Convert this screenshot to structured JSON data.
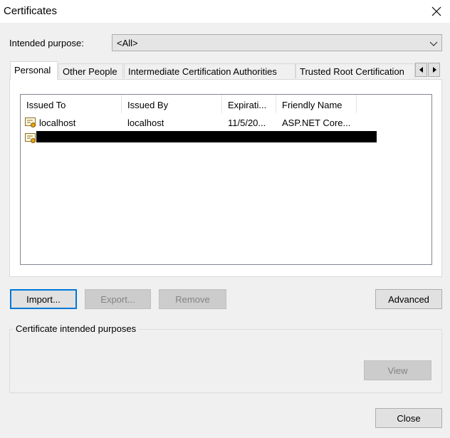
{
  "window": {
    "title": "Certificates"
  },
  "purpose": {
    "label": "Intended purpose:",
    "value": "<All>"
  },
  "tabs": [
    {
      "label": "Personal"
    },
    {
      "label": "Other People"
    },
    {
      "label": "Intermediate Certification Authorities"
    },
    {
      "label": "Trusted Root Certification"
    }
  ],
  "list": {
    "columns": [
      "Issued To",
      "Issued By",
      "Expirati...",
      "Friendly Name"
    ],
    "rows": [
      {
        "issued_to": "localhost",
        "issued_by": "localhost",
        "expiration": "11/5/20...",
        "friendly_name": "ASP.NET Core..."
      }
    ]
  },
  "buttons": {
    "import": "Import...",
    "export": "Export...",
    "remove": "Remove",
    "advanced": "Advanced",
    "view": "View",
    "close": "Close"
  },
  "group": {
    "legend": "Certificate intended purposes"
  },
  "icons": {
    "close": "close-icon",
    "dropdown": "chevron-down-icon",
    "tab_left": "triangle-left-icon",
    "tab_right": "triangle-right-icon",
    "certificate": "certificate-icon"
  },
  "colors": {
    "accent": "#0078d7",
    "window_bg": "#f0f0f0"
  }
}
